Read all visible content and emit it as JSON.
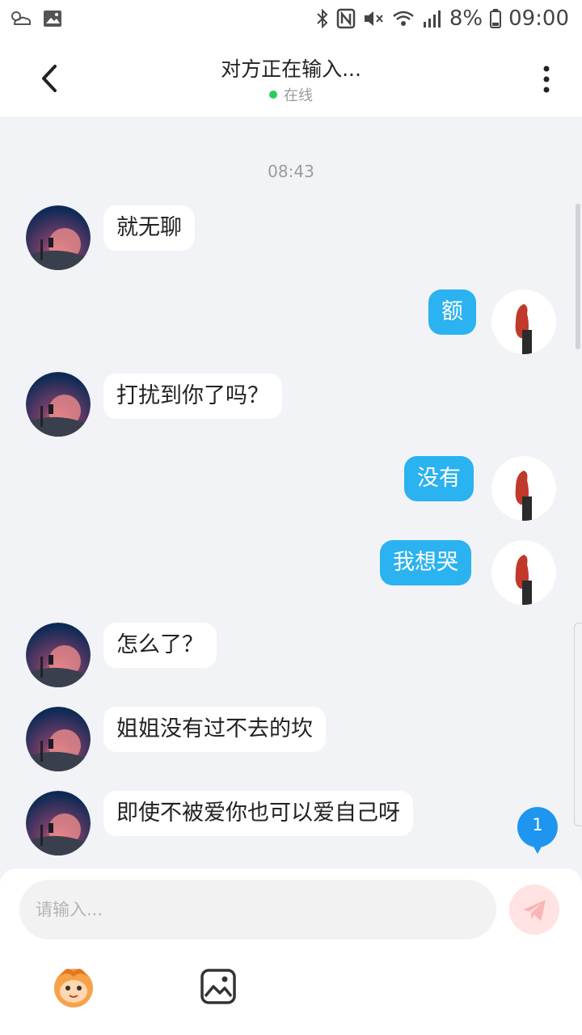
{
  "status_bar": {
    "battery": "8%",
    "time": "09:00"
  },
  "header": {
    "title": "对方正在输入...",
    "status": "在线"
  },
  "chat": {
    "timestamp": "08:43",
    "messages": [
      {
        "side": "in",
        "text": "就无聊"
      },
      {
        "side": "out",
        "text": "额"
      },
      {
        "side": "in",
        "text": "打扰到你了吗？"
      },
      {
        "side": "out",
        "text": "没有"
      },
      {
        "side": "out",
        "text": "我想哭"
      },
      {
        "side": "in",
        "text": "怎么了？"
      },
      {
        "side": "in",
        "text": "姐姐没有过不去的坎"
      },
      {
        "side": "in",
        "text": "即使不被爱你也可以爱自己呀"
      }
    ],
    "unread_badge": "1"
  },
  "composer": {
    "placeholder": "请输入..."
  },
  "colors": {
    "outgoing_bubble": "#2bb2f0",
    "incoming_bubble": "#ffffff",
    "online_dot": "#2ecc5b"
  },
  "icons": [
    "back-icon",
    "more-vertical-icon",
    "send-icon",
    "emoji-icon",
    "image-icon"
  ]
}
